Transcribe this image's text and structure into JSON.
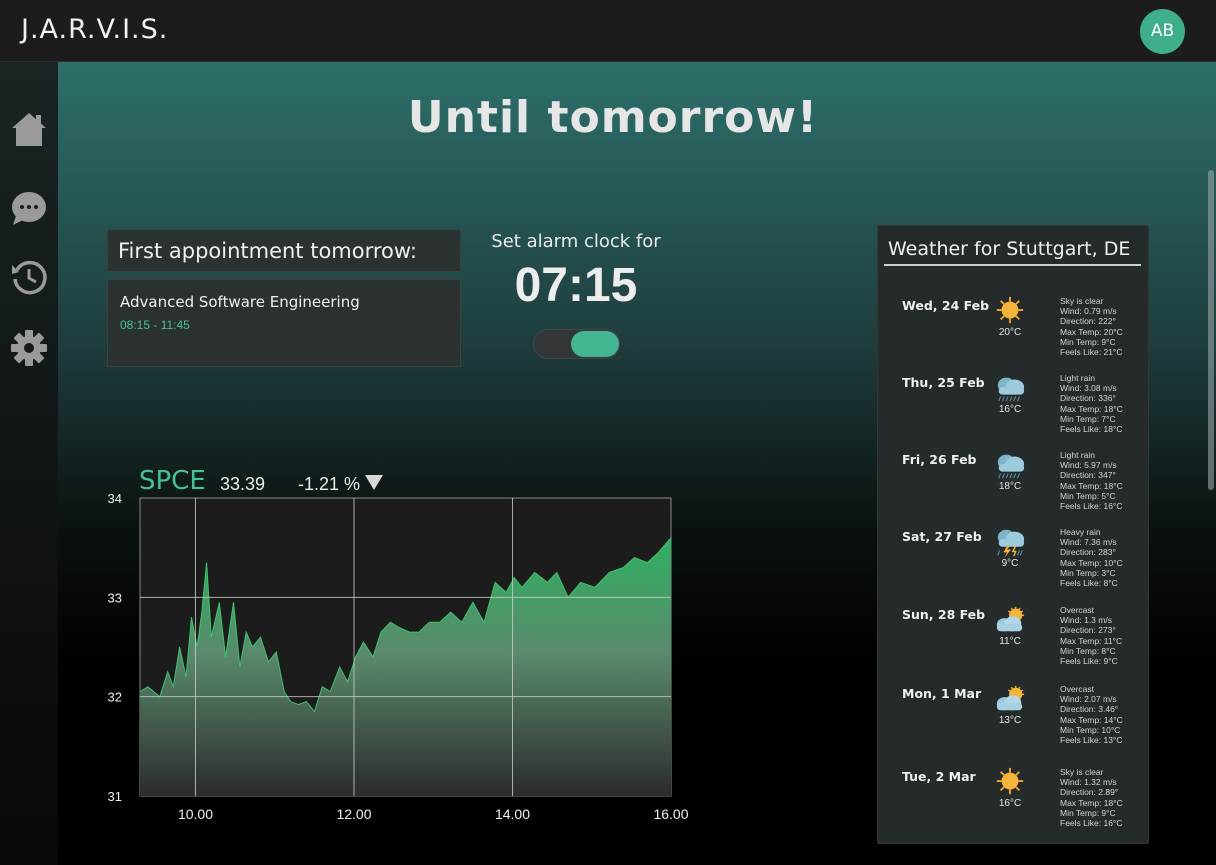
{
  "app": {
    "title": "J.A.R.V.I.S.",
    "user_initials": "AB"
  },
  "sidebar": {
    "items": [
      {
        "name": "home",
        "icon": "home-icon"
      },
      {
        "name": "chat",
        "icon": "chat-icon"
      },
      {
        "name": "history",
        "icon": "history-icon"
      },
      {
        "name": "settings",
        "icon": "gear-icon"
      }
    ]
  },
  "main": {
    "heading": "Until tomorrow!"
  },
  "appointment": {
    "title": "First appointment tomorrow:",
    "name": "Advanced Software Engineering",
    "time": "08:15 - 11:45"
  },
  "alarm": {
    "label": "Set alarm clock for",
    "time": "07:15",
    "enabled": true
  },
  "stock": {
    "symbol": "SPCE",
    "price": "33.39",
    "change": "-1.21 %"
  },
  "chart_data": {
    "type": "area",
    "title": "",
    "xlabel": "",
    "ylabel": "",
    "xlim": [
      9.3,
      16.0
    ],
    "ylim": [
      31,
      34
    ],
    "x_ticks": [
      10,
      12,
      14,
      16
    ],
    "x_tick_labels": [
      "10.00",
      "12.00",
      "14.00",
      "16.00"
    ],
    "y_ticks": [
      31,
      32,
      33,
      34
    ],
    "y_tick_labels": [
      "31",
      "32",
      "33",
      "34"
    ],
    "grid": true,
    "series": [
      {
        "x": [
          9.3,
          9.4,
          9.55,
          9.65,
          9.72,
          9.8,
          9.88,
          9.95,
          10.02,
          10.08,
          10.14,
          10.2,
          10.3,
          10.38,
          10.48,
          10.56,
          10.64,
          10.72,
          10.82,
          10.92,
          11.02,
          11.12,
          11.2,
          11.3,
          11.4,
          11.5,
          11.6,
          11.7,
          11.82,
          11.92,
          12.02,
          12.12,
          12.24,
          12.34,
          12.46,
          12.56,
          12.7,
          12.82,
          12.95,
          13.08,
          13.22,
          13.36,
          13.5,
          13.64,
          13.78,
          13.92,
          14.02,
          14.12,
          14.28,
          14.44,
          14.56,
          14.7,
          14.86,
          15.04,
          15.22,
          15.4,
          15.54,
          15.7,
          15.84,
          16.0
        ],
        "y": [
          32.05,
          32.1,
          32.0,
          32.25,
          32.1,
          32.5,
          32.2,
          32.8,
          32.5,
          32.85,
          33.35,
          32.6,
          32.95,
          32.4,
          32.95,
          32.3,
          32.65,
          32.5,
          32.6,
          32.35,
          32.45,
          32.05,
          31.95,
          31.92,
          31.95,
          31.85,
          32.1,
          32.05,
          32.3,
          32.15,
          32.4,
          32.55,
          32.4,
          32.65,
          32.75,
          32.7,
          32.65,
          32.65,
          32.75,
          32.75,
          32.85,
          32.75,
          32.95,
          32.75,
          33.15,
          33.05,
          33.2,
          33.1,
          33.25,
          33.15,
          33.25,
          33.0,
          33.15,
          33.1,
          33.25,
          33.3,
          33.4,
          33.35,
          33.45,
          33.6
        ]
      }
    ]
  },
  "weather": {
    "title": "Weather for Stuttgart, DE",
    "days": [
      {
        "date": "Wed, 24 Feb",
        "icon": "sun-icon",
        "temp": "20°C",
        "desc": "Sky is clear",
        "wind": "Wind: 0.79 m/s",
        "direction": "Direction: 222°",
        "max": "Max Temp: 20°C",
        "min": "Min Temp: 9°C",
        "feels": "Feels Like: 21°C"
      },
      {
        "date": "Thu, 25 Feb",
        "icon": "rain-cloud-icon",
        "temp": "16°C",
        "desc": "Light rain",
        "wind": "Wind: 3.08 m/s",
        "direction": "Direction: 336°",
        "max": "Max Temp: 18°C",
        "min": "Min Temp: 7°C",
        "feels": "Feels Like: 18°C"
      },
      {
        "date": "Fri, 26 Feb",
        "icon": "rain-cloud-icon",
        "temp": "18°C",
        "desc": "Light rain",
        "wind": "Wind: 5.97 m/s",
        "direction": "Direction: 347°",
        "max": "Max Temp: 18°C",
        "min": "Min Temp: 5°C",
        "feels": "Feels Like: 16°C"
      },
      {
        "date": "Sat, 27 Feb",
        "icon": "thunderstorm-icon",
        "temp": "9°C",
        "desc": "Heavy rain",
        "wind": "Wind: 7.36 m/s",
        "direction": "Direction: 283°",
        "max": "Max Temp: 10°C",
        "min": "Min Temp: 3°C",
        "feels": "Feels Like: 8°C"
      },
      {
        "date": "Sun, 28 Feb",
        "icon": "partly-cloudy-icon",
        "temp": "11°C",
        "desc": "Overcast",
        "wind": "Wind: 1.3 m/s",
        "direction": "Direction: 273°",
        "max": "Max Temp: 11°C",
        "min": "Min Temp: 8°C",
        "feels": "Feels Like: 9°C"
      },
      {
        "date": "Mon, 1 Mar",
        "icon": "partly-cloudy-icon",
        "temp": "13°C",
        "desc": "Overcast",
        "wind": "Wind: 2.07 m/s",
        "direction": "Direction: 3.46°",
        "max": "Max Temp: 14°C",
        "min": "Min Temp: 10°C",
        "feels": "Feels Like: 13°C"
      },
      {
        "date": "Tue, 2 Mar",
        "icon": "sun-icon",
        "temp": "16°C",
        "desc": "Sky is clear",
        "wind": "Wind: 1.32 m/s",
        "direction": "Direction: 2.89°",
        "max": "Max Temp: 18°C",
        "min": "Min Temp: 9°C",
        "feels": "Feels Like: 16°C"
      }
    ]
  },
  "colors": {
    "accent": "#45b693",
    "topbar": "#1c1c1c",
    "panel": "#252a2a"
  }
}
